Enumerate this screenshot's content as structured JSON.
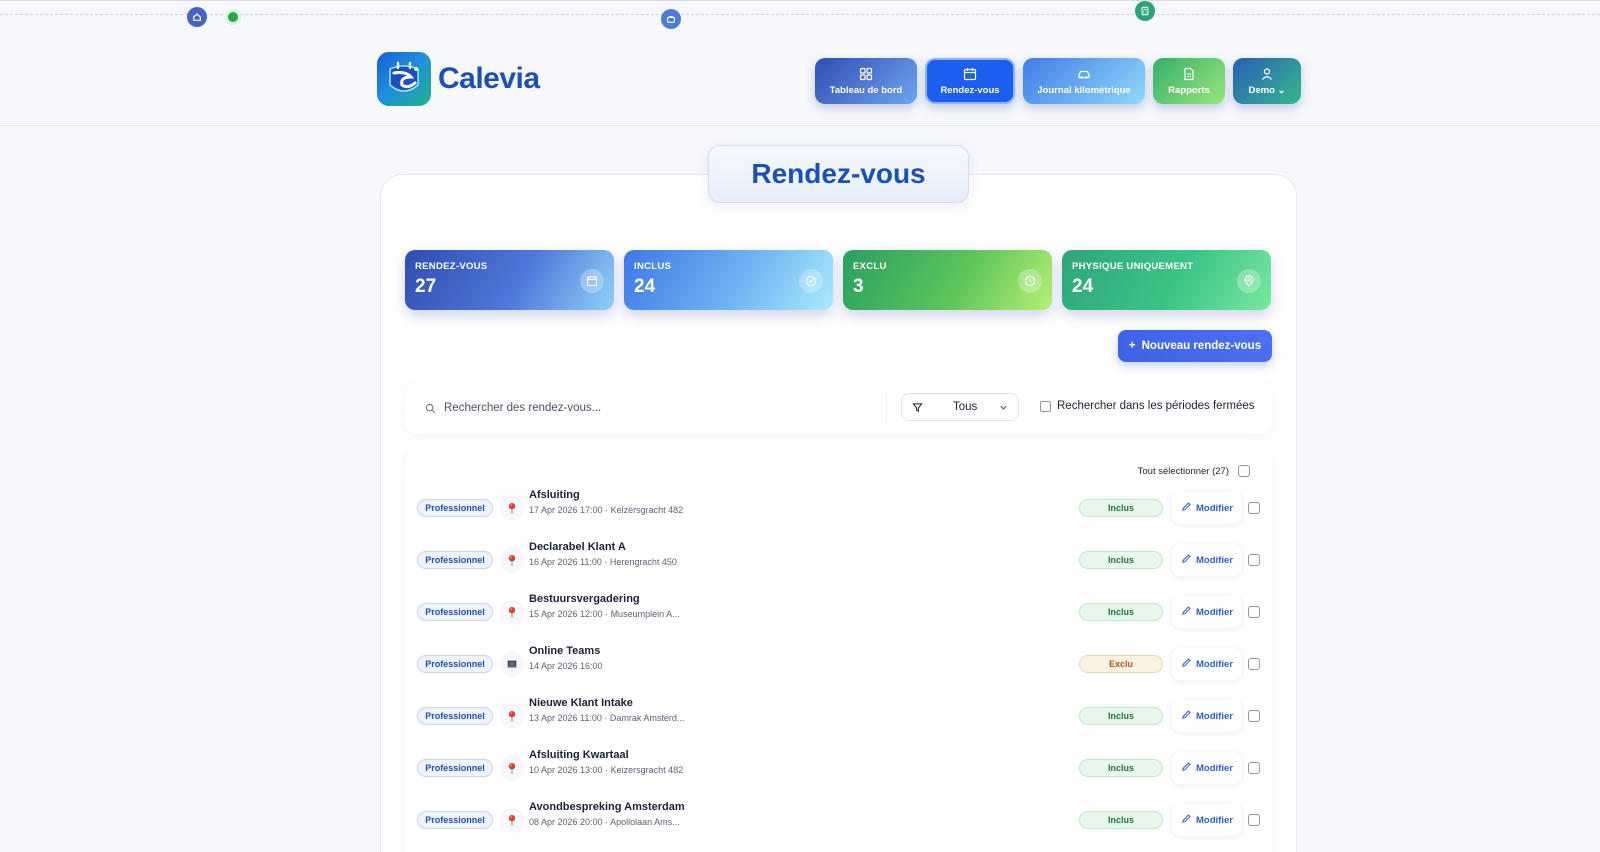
{
  "brand": {
    "name": "Calevia"
  },
  "nav": [
    {
      "label": "Tableau de bord",
      "icon": "dashboard-icon"
    },
    {
      "label": "Rendez-vous",
      "icon": "calendar-icon"
    },
    {
      "label": "Journal kilométrique",
      "icon": "car-icon"
    },
    {
      "label": "Rapports",
      "icon": "document-icon"
    },
    {
      "label": "Demo",
      "icon": "user-icon"
    }
  ],
  "page": {
    "title": "Rendez-vous"
  },
  "stats": [
    {
      "label": "RENDEZ-VOUS",
      "value": "27",
      "icon": "calendar-icon"
    },
    {
      "label": "INCLUS",
      "value": "24",
      "icon": "check-circle-icon"
    },
    {
      "label": "EXCLU",
      "value": "3",
      "icon": "clock-icon"
    },
    {
      "label": "PHYSIQUE UNIQUEMENT",
      "value": "24",
      "icon": "location-icon"
    }
  ],
  "actions": {
    "new_label": "Nouveau rendez-vous"
  },
  "filters": {
    "search_placeholder": "Rechercher des rendez-vous...",
    "type_value": "Tous",
    "closed_label": "Rechercher dans les périodes fermées"
  },
  "list": {
    "select_all_label": "Tout sélectionner (27)",
    "edit_label": "Modifier",
    "rows": [
      {
        "tag": "Professionnel",
        "kind": "location-pin",
        "title": "Afsluiting",
        "subtitle": "17 Apr 2026 17:00 · Keizersgracht 482",
        "status": "Inclus"
      },
      {
        "tag": "Professionnel",
        "kind": "location-pin",
        "title": "Declarabel Klant A",
        "subtitle": "16 Apr 2026 11:00 · Herengracht 450",
        "status": "Inclus"
      },
      {
        "tag": "Professionnel",
        "kind": "location-pin",
        "title": "Bestuursvergadering",
        "subtitle": "15 Apr 2026 12:00 · Museumplein A...",
        "status": "Inclus"
      },
      {
        "tag": "Professionnel",
        "kind": "laptop",
        "title": "Online Teams",
        "subtitle": "14 Apr 2026 16:00",
        "status": "Exclu"
      },
      {
        "tag": "Professionnel",
        "kind": "location-pin",
        "title": "Nieuwe Klant Intake",
        "subtitle": "13 Apr 2026 11:00 · Damrak Amsterd...",
        "status": "Inclus"
      },
      {
        "tag": "Professionnel",
        "kind": "location-pin",
        "title": "Afsluiting Kwartaal",
        "subtitle": "10 Apr 2026 13:00 · Keizersgracht 482",
        "status": "Inclus"
      },
      {
        "tag": "Professionnel",
        "kind": "location-pin",
        "title": "Avondbespreking Amsterdam",
        "subtitle": "08 Apr 2026 20:00 · Apollolaan Ams...",
        "status": "Inclus"
      }
    ]
  },
  "colors": {
    "primary": "#1d4fb8",
    "accent": "#1c5ef0",
    "included": "#1c7a3e",
    "excluded": "#b4581a"
  }
}
